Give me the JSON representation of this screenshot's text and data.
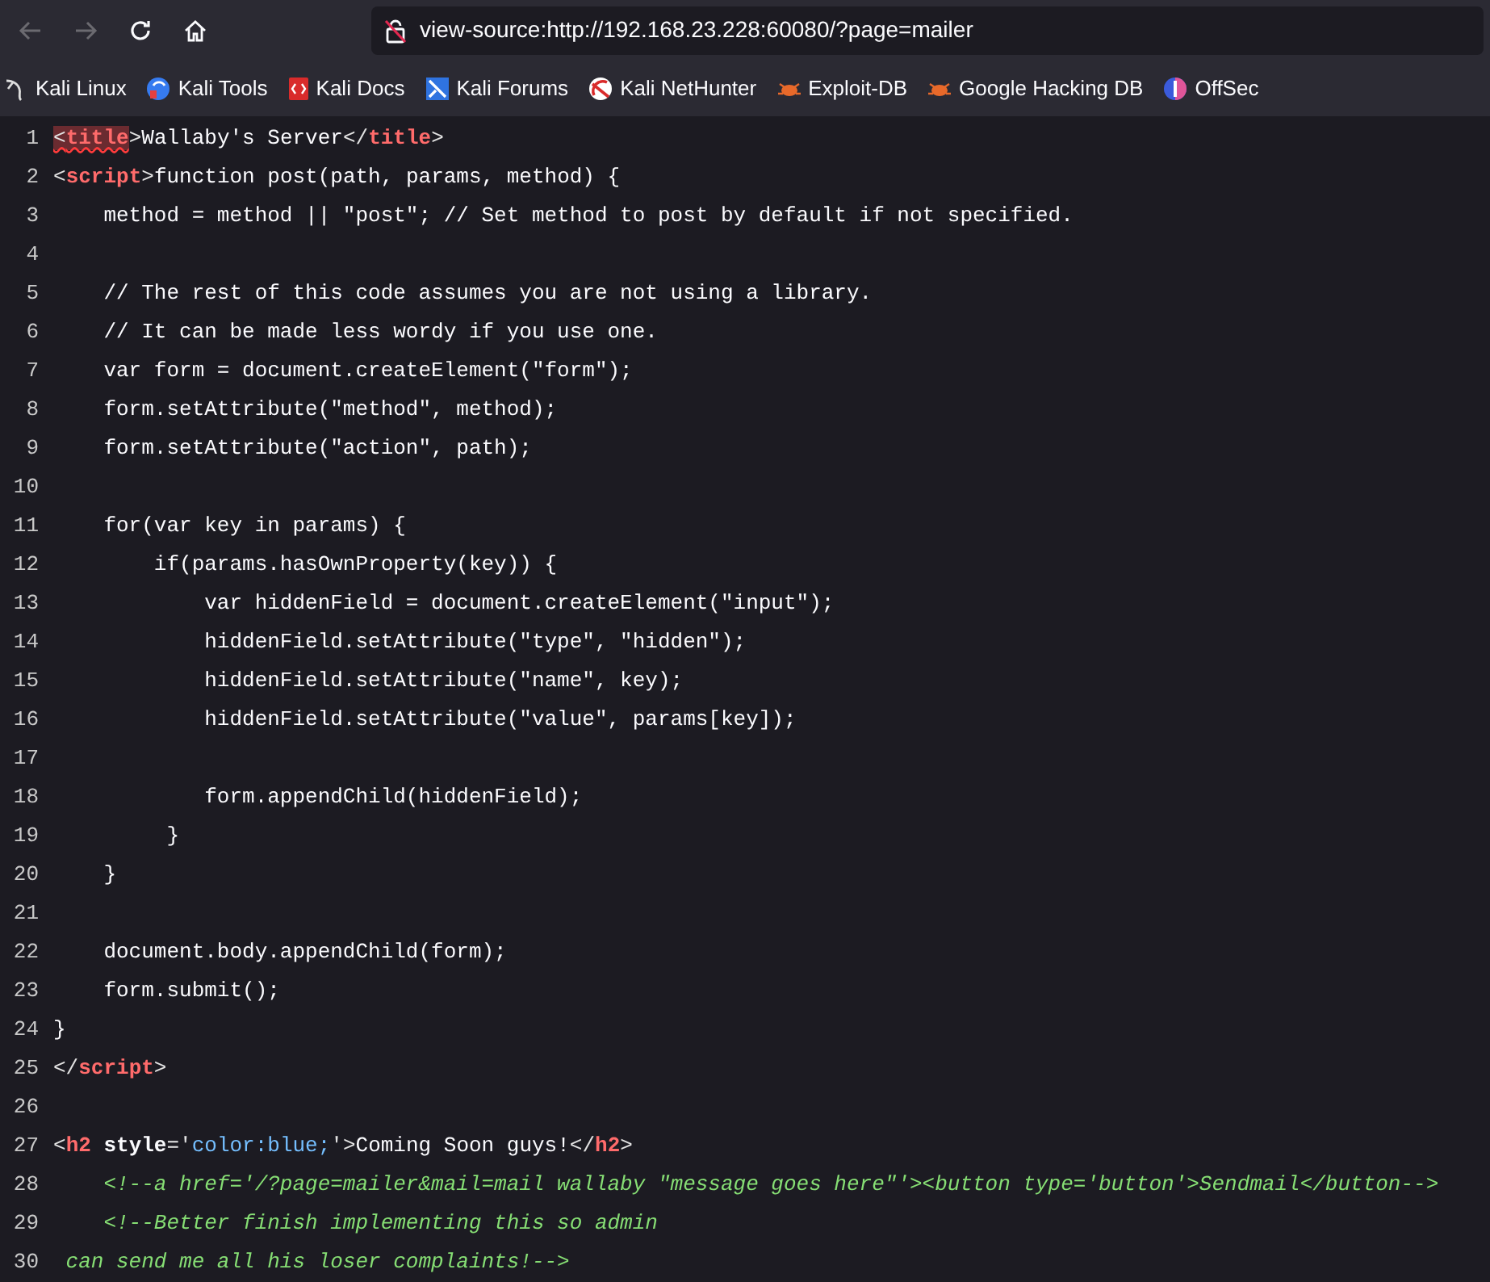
{
  "toolbar": {
    "back": {
      "disabled": true
    },
    "forward": {
      "disabled": true
    },
    "url": "view-source:http://192.168.23.228:60080/?page=mailer"
  },
  "bookmarks": [
    {
      "label": "Kali Linux",
      "kind": "dragon"
    },
    {
      "label": "Kali Tools",
      "kind": "tools"
    },
    {
      "label": "Kali Docs",
      "kind": "docs"
    },
    {
      "label": "Kali Forums",
      "kind": "forums"
    },
    {
      "label": "Kali NetHunter",
      "kind": "nethunter"
    },
    {
      "label": "Exploit-DB",
      "kind": "bug"
    },
    {
      "label": "Google Hacking DB",
      "kind": "bug"
    },
    {
      "label": "OffSec",
      "kind": "offsec"
    }
  ],
  "source": {
    "lines": [
      {
        "number": "1",
        "segments": [
          {
            "kind": "punct",
            "text": "<",
            "error": true
          },
          {
            "kind": "tag",
            "text": "title",
            "error": true
          },
          {
            "kind": "punct",
            "text": ">"
          },
          {
            "kind": "text",
            "text": "Wallaby's Server"
          },
          {
            "kind": "punct",
            "text": "</"
          },
          {
            "kind": "tag",
            "text": "title"
          },
          {
            "kind": "punct",
            "text": ">"
          }
        ]
      },
      {
        "number": "2",
        "segments": [
          {
            "kind": "punct",
            "text": "<"
          },
          {
            "kind": "tag",
            "text": "script"
          },
          {
            "kind": "punct",
            "text": ">"
          },
          {
            "kind": "text",
            "text": "function post(path, params, method) {"
          }
        ]
      },
      {
        "number": "3",
        "segments": [
          {
            "kind": "text",
            "text": "    method = method || \"post\"; // Set method to post by default if not specified."
          }
        ]
      },
      {
        "number": "4"
      },
      {
        "number": "5",
        "segments": [
          {
            "kind": "text",
            "text": "    // The rest of this code assumes you are not using a library."
          }
        ]
      },
      {
        "number": "6",
        "segments": [
          {
            "kind": "text",
            "text": "    // It can be made less wordy if you use one."
          }
        ]
      },
      {
        "number": "7",
        "segments": [
          {
            "kind": "text",
            "text": "    var form = document.createElement(\"form\");"
          }
        ]
      },
      {
        "number": "8",
        "segments": [
          {
            "kind": "text",
            "text": "    form.setAttribute(\"method\", method);"
          }
        ]
      },
      {
        "number": "9",
        "segments": [
          {
            "kind": "text",
            "text": "    form.setAttribute(\"action\", path);"
          }
        ]
      },
      {
        "number": "10"
      },
      {
        "number": "11",
        "segments": [
          {
            "kind": "text",
            "text": "    for(var key in params) {"
          }
        ]
      },
      {
        "number": "12",
        "segments": [
          {
            "kind": "text",
            "text": "        if(params.hasOwnProperty(key)) {"
          }
        ]
      },
      {
        "number": "13",
        "segments": [
          {
            "kind": "text",
            "text": "            var hiddenField = document.createElement(\"input\");"
          }
        ]
      },
      {
        "number": "14",
        "segments": [
          {
            "kind": "text",
            "text": "            hiddenField.setAttribute(\"type\", \"hidden\");"
          }
        ]
      },
      {
        "number": "15",
        "segments": [
          {
            "kind": "text",
            "text": "            hiddenField.setAttribute(\"name\", key);"
          }
        ]
      },
      {
        "number": "16",
        "segments": [
          {
            "kind": "text",
            "text": "            hiddenField.setAttribute(\"value\", params[key]);"
          }
        ]
      },
      {
        "number": "17"
      },
      {
        "number": "18",
        "segments": [
          {
            "kind": "text",
            "text": "            form.appendChild(hiddenField);"
          }
        ]
      },
      {
        "number": "19",
        "segments": [
          {
            "kind": "text",
            "text": "         }"
          }
        ]
      },
      {
        "number": "20",
        "segments": [
          {
            "kind": "text",
            "text": "    }"
          }
        ]
      },
      {
        "number": "21"
      },
      {
        "number": "22",
        "segments": [
          {
            "kind": "text",
            "text": "    document.body.appendChild(form);"
          }
        ]
      },
      {
        "number": "23",
        "segments": [
          {
            "kind": "text",
            "text": "    form.submit();"
          }
        ]
      },
      {
        "number": "24",
        "segments": [
          {
            "kind": "text",
            "text": "}"
          }
        ]
      },
      {
        "number": "25",
        "segments": [
          {
            "kind": "punct",
            "text": "</"
          },
          {
            "kind": "tag",
            "text": "script"
          },
          {
            "kind": "punct",
            "text": ">"
          }
        ]
      },
      {
        "number": "26"
      },
      {
        "number": "27",
        "segments": [
          {
            "kind": "punct",
            "text": "<"
          },
          {
            "kind": "tag",
            "text": "h2"
          },
          {
            "kind": "attr",
            "text": " style"
          },
          {
            "kind": "punct",
            "text": "='"
          },
          {
            "kind": "value",
            "text": "color:blue;"
          },
          {
            "kind": "punct",
            "text": "'>"
          },
          {
            "kind": "text",
            "text": "Coming Soon guys!"
          },
          {
            "kind": "punct",
            "text": "</"
          },
          {
            "kind": "tag",
            "text": "h2"
          },
          {
            "kind": "punct",
            "text": ">"
          }
        ]
      },
      {
        "number": "28",
        "segments": [
          {
            "kind": "comment",
            "text": "    <!--a href='/?page=mailer&mail=mail wallaby \"message goes here\"'><button type='button'>Sendmail</button-->"
          }
        ]
      },
      {
        "number": "29",
        "segments": [
          {
            "kind": "comment",
            "text": "    <!--Better finish implementing this so admin"
          }
        ]
      },
      {
        "number": "30",
        "segments": [
          {
            "kind": "comment",
            "text": " can send me all his loser complaints!-->"
          }
        ]
      }
    ]
  }
}
